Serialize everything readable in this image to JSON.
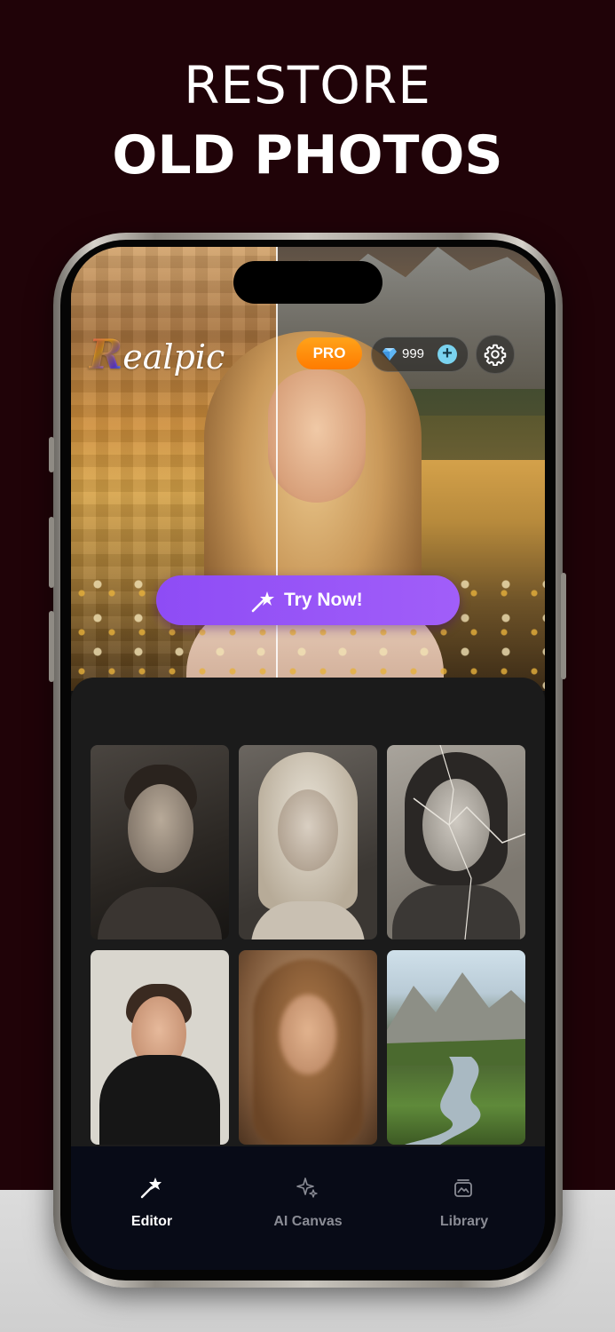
{
  "promo": {
    "line1": "RESTORE",
    "line2": "OLD PHOTOS"
  },
  "app": {
    "logo_text": "Realpic",
    "logo_initial": "R",
    "logo_rest": "ealpic",
    "pro_badge": "PRO",
    "gem_count": "999",
    "plus_symbol": "+",
    "try_now_label": "Try Now!"
  },
  "gallery": {
    "items": [
      {
        "subject": "man-portrait-sepia"
      },
      {
        "subject": "blonde-woman-sepia"
      },
      {
        "subject": "girl-cracked-photo"
      },
      {
        "subject": "young-man-confetti"
      },
      {
        "subject": "blurry-woman-portrait"
      },
      {
        "subject": "mountain-river-landscape"
      }
    ]
  },
  "tabs": [
    {
      "label": "Editor",
      "icon": "magic-wand-icon",
      "active": true
    },
    {
      "label": "AI Canvas",
      "icon": "sparkles-icon",
      "active": false
    },
    {
      "label": "Library",
      "icon": "photo-stack-icon",
      "active": false
    }
  ],
  "colors": {
    "background": "#200308",
    "accent_purple": "#9654f7",
    "pro_orange": "#ff8c0a",
    "gem_blue": "#7ad3ef",
    "tab_active": "#ffffff",
    "tab_inactive": "#8a8c95"
  }
}
